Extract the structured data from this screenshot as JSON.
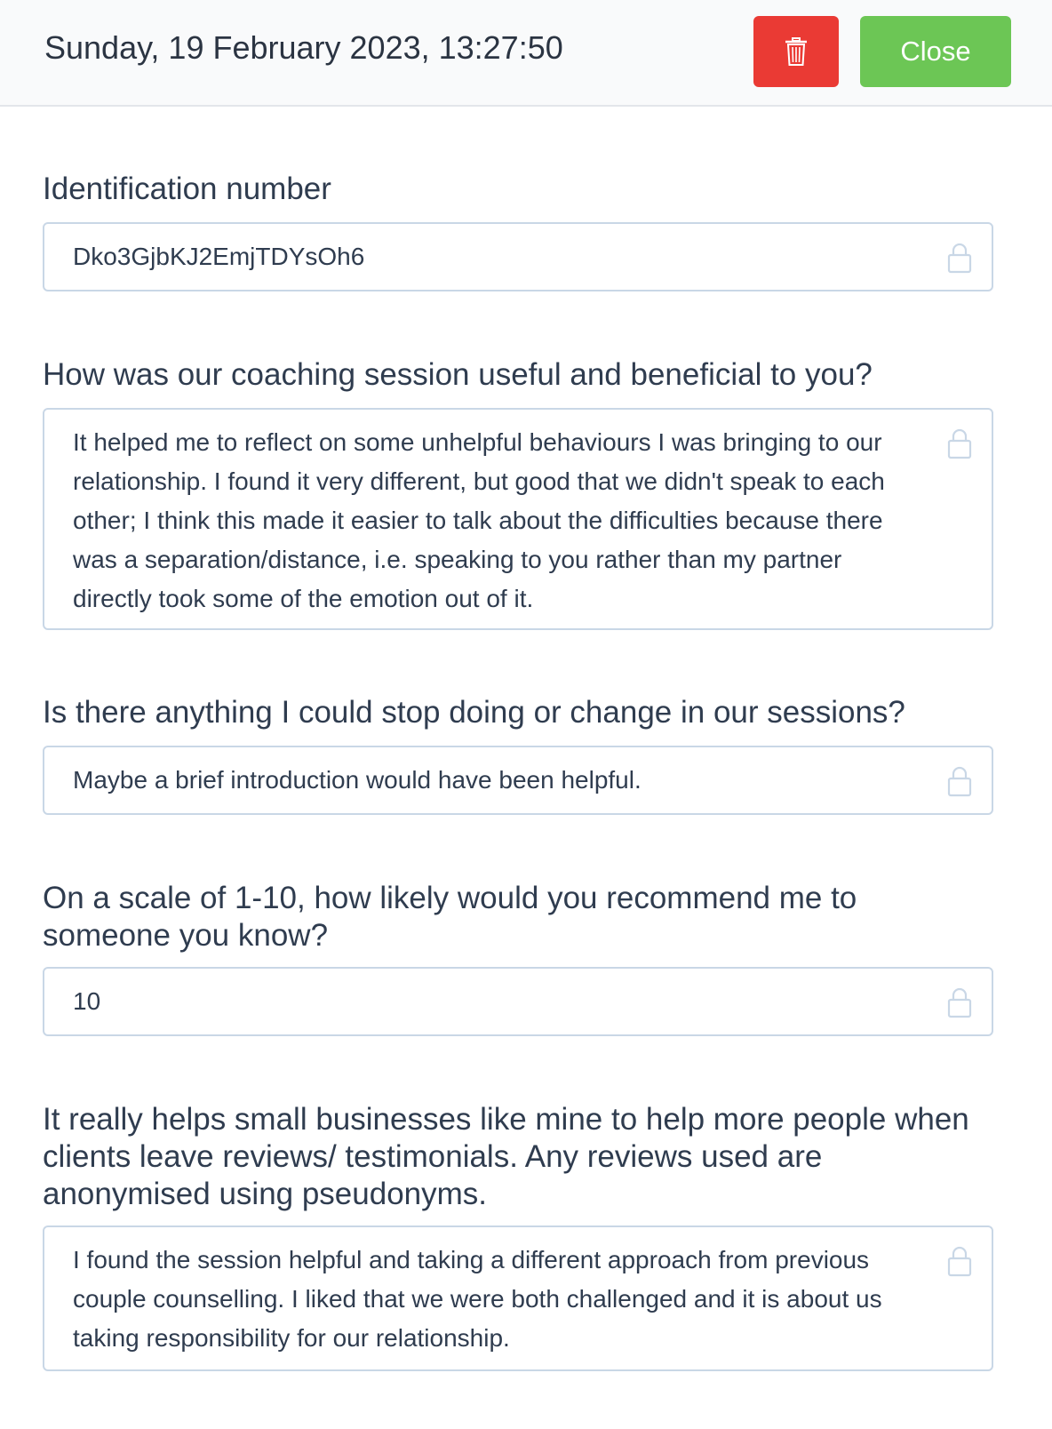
{
  "header": {
    "title": "Sunday, 19 February 2023, 13:27:50",
    "delete_icon": "trash-icon",
    "delete_color": "#ea3a34",
    "close_label": "Close",
    "close_color": "#6cc655"
  },
  "fields": [
    {
      "label": "Identification number",
      "value": "Dko3GjbKJ2EmjTDYsOh6",
      "icon": "lock-icon"
    },
    {
      "label": "How was our coaching session useful and beneficial to you?",
      "value": "It helped me to reflect on some unhelpful behaviours I was bringing to our relationship. I found it very different, but good that we didn't speak to each other; I think this made it easier to talk about the difficulties because there was a separation/distance, i.e. speaking to you rather than my partner directly took some of the emotion out of it.",
      "icon": "lock-icon"
    },
    {
      "label": "Is there anything I could stop doing or change in our sessions?",
      "value": "Maybe a brief introduction would have been helpful.",
      "icon": "lock-icon"
    },
    {
      "label": "On a scale of 1-10, how likely would you recommend me to someone you know?",
      "value": "10",
      "icon": "lock-icon"
    },
    {
      "label": "It really helps small businesses like mine to help more people when clients leave reviews/ testimonials. Any reviews used are anonymised using pseudonyms.",
      "value": "I found the session helpful and taking a different approach from previous couple counselling. I liked that we were both challenged and it is about us taking responsibility for our relationship.",
      "icon": "lock-icon"
    }
  ]
}
